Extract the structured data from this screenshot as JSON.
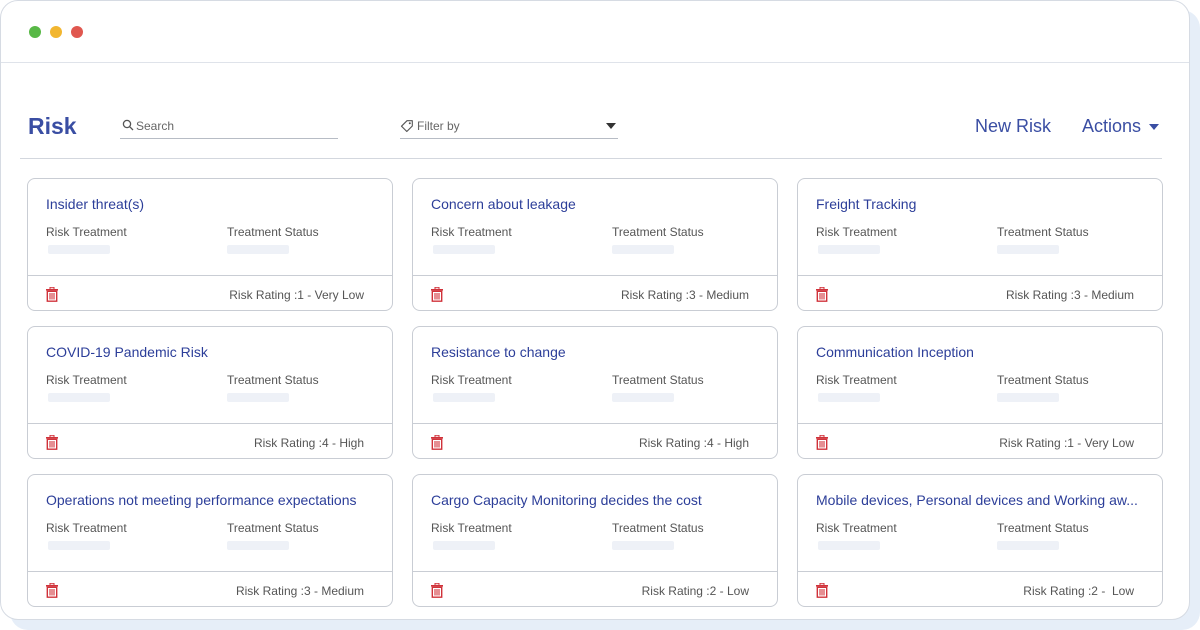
{
  "window": {
    "controls": [
      {
        "name": "green",
        "color": "#58b846"
      },
      {
        "name": "yellow",
        "color": "#f2b630"
      },
      {
        "name": "red",
        "color": "#e0574f"
      }
    ]
  },
  "header": {
    "title": "Risk",
    "search_placeholder": "Search",
    "filter_label": "Filter by",
    "new_risk_label": "New Risk",
    "actions_label": "Actions"
  },
  "labels": {
    "risk_treatment": "Risk Treatment",
    "treatment_status": "Treatment Status"
  },
  "colors": {
    "accent": "#3a4ea3",
    "delete": "#d0323a"
  },
  "cards": [
    {
      "title": "Insider threat(s)",
      "rating_prefix": "Risk Rating :1",
      "rating_level": " - Very Low"
    },
    {
      "title": "Concern about leakage",
      "rating_prefix": "Risk Rating :3",
      "rating_level": " - Medium"
    },
    {
      "title": "Freight Tracking",
      "rating_prefix": "Risk Rating :3",
      "rating_level": " - Medium"
    },
    {
      "title": "COVID-19 Pandemic Risk",
      "rating_prefix": "Risk Rating :4",
      "rating_level": " - High"
    },
    {
      "title": "Resistance to change",
      "rating_prefix": "Risk Rating :4",
      "rating_level": " - High"
    },
    {
      "title": "Communication Inception",
      "rating_prefix": "Risk Rating :1",
      "rating_level": " - Very Low"
    },
    {
      "title": "Operations not meeting performance expectations",
      "rating_prefix": "Risk Rating :3",
      "rating_level": " - Medium"
    },
    {
      "title": "Cargo Capacity Monitoring decides the cost",
      "rating_prefix": "Risk Rating :2",
      "rating_level": " - Low"
    },
    {
      "title": "Mobile devices, Personal devices and Working aw...",
      "rating_prefix": "Risk Rating :2",
      "rating_level": " -  Low"
    }
  ]
}
